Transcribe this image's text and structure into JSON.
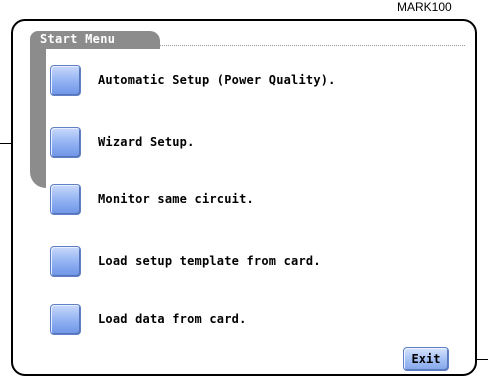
{
  "doc_label": "MARK100",
  "window": {
    "title": "Start Menu"
  },
  "menu": {
    "items": [
      {
        "label": "Automatic Setup (Power Quality)."
      },
      {
        "label": "Wizard Setup."
      },
      {
        "label": "Monitor same circuit."
      },
      {
        "label": "Load setup template from card."
      },
      {
        "label": "Load data from card."
      }
    ]
  },
  "footer": {
    "exit_label": "Exit"
  },
  "colors": {
    "button_blue": "#8fb0f2",
    "frame_gray": "#8c8c8c"
  }
}
